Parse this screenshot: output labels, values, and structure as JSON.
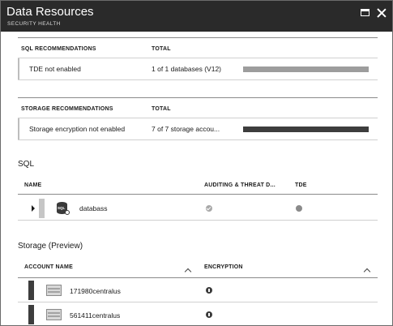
{
  "header": {
    "title": "Data Resources",
    "subtitle": "SECURITY HEALTH",
    "maximize_icon": "maximize-icon",
    "close_icon": "close-icon",
    "background": "#2a2a2a"
  },
  "sql_recommendations": {
    "col_name": "SQL RECOMMENDATIONS",
    "col_total": "TOTAL",
    "rows": [
      {
        "name": "TDE not enabled",
        "total": "1 of 1 databases (V12)",
        "progress": 1.0,
        "bar_color": "#9d9d9d"
      }
    ]
  },
  "storage_recommendations": {
    "col_name": "STORAGE RECOMMENDATIONS",
    "col_total": "TOTAL",
    "rows": [
      {
        "name": "Storage encryption not enabled",
        "total": "7 of 7 storage accou...",
        "progress": 1.0,
        "bar_color": "#3d3d3d"
      }
    ]
  },
  "sql_section": {
    "title": "SQL",
    "col_name": "NAME",
    "col_auditing": "AUDITING & THREAT D...",
    "col_tde": "TDE",
    "rows": [
      {
        "name": "databass",
        "icon": "sql-database-icon",
        "auditing_status": "check-icon",
        "tde_status": "gray-dot-icon"
      }
    ]
  },
  "storage_section": {
    "title": "Storage (Preview)",
    "col_account": "ACCOUNT NAME",
    "col_encryption": "ENCRYPTION",
    "rows": [
      {
        "name": "171980centralus",
        "icon": "storage-account-icon",
        "encryption_status": "info-icon"
      },
      {
        "name": "561411centralus",
        "icon": "storage-account-icon",
        "encryption_status": "info-icon"
      }
    ]
  }
}
